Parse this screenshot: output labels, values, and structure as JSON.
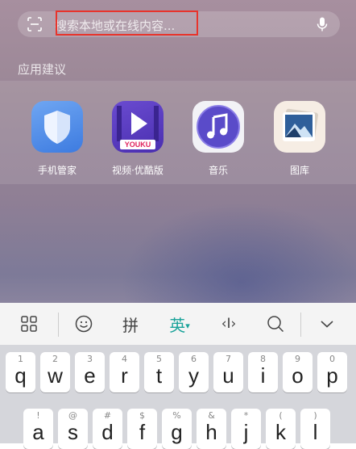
{
  "search": {
    "placeholder": "搜索本地或在线内容...",
    "scan_icon": "scan-icon",
    "mic_icon": "microphone-icon"
  },
  "section": {
    "title": "应用建议"
  },
  "apps": [
    {
      "label": "手机管家",
      "icon": "shield-icon"
    },
    {
      "label": "视频·优酷版",
      "icon": "video-play-icon",
      "badge": "YOUKU"
    },
    {
      "label": "音乐",
      "icon": "music-note-icon"
    },
    {
      "label": "图库",
      "icon": "gallery-icon"
    }
  ],
  "toolbar": {
    "pinyin": "拼",
    "english": "英",
    "english_arrow": "▾",
    "cursor": "‹I›"
  },
  "keyboard": {
    "row1": [
      {
        "sub": "1",
        "main": "q"
      },
      {
        "sub": "2",
        "main": "w"
      },
      {
        "sub": "3",
        "main": "e"
      },
      {
        "sub": "4",
        "main": "r"
      },
      {
        "sub": "5",
        "main": "t"
      },
      {
        "sub": "6",
        "main": "y"
      },
      {
        "sub": "7",
        "main": "u"
      },
      {
        "sub": "8",
        "main": "i"
      },
      {
        "sub": "9",
        "main": "o"
      },
      {
        "sub": "0",
        "main": "p"
      }
    ],
    "row2": [
      {
        "sub": "!",
        "main": "a"
      },
      {
        "sub": "@",
        "main": "s"
      },
      {
        "sub": "#",
        "main": "d"
      },
      {
        "sub": "$",
        "main": "f"
      },
      {
        "sub": "%",
        "main": "g"
      },
      {
        "sub": "&",
        "main": "h"
      },
      {
        "sub": "*",
        "main": "j"
      },
      {
        "sub": "(",
        "main": "k"
      },
      {
        "sub": ")",
        "main": "l"
      }
    ]
  },
  "colors": {
    "accent": "#1aa39a",
    "highlight": "#e8342c"
  }
}
